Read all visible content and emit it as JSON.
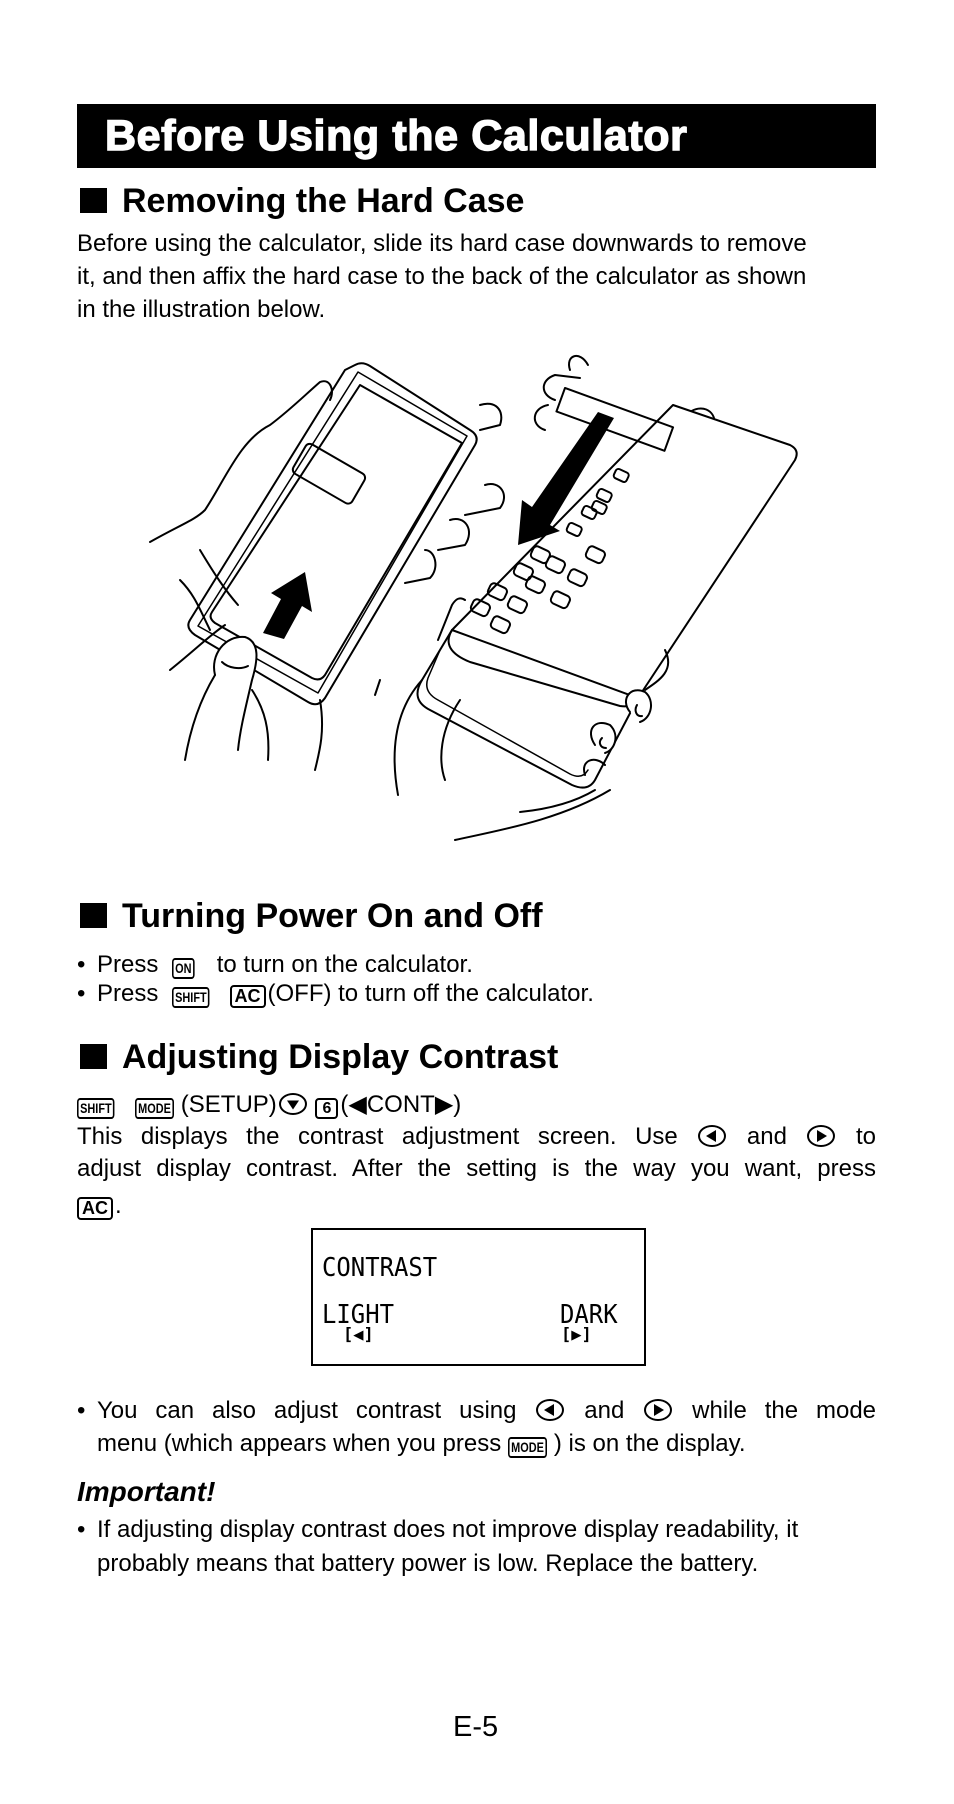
{
  "page": {
    "title": "Before Using the Calculator",
    "page_number": "E-5"
  },
  "sections": {
    "hard_case": {
      "heading": "Removing the Hard Case",
      "paragraph_lines": [
        "Before using the calculator, slide its hard case downwards to remove",
        "it, and then affix the hard case to the back of the calculator as shown",
        "in the illustration below."
      ],
      "illustration": {
        "left_figure": "calculator-back-with-case-slide-up-arrow",
        "right_figure": "calculator-front-case-slide-down-arrow"
      }
    },
    "power": {
      "heading": "Turning Power On and Off",
      "bullets": [
        {
          "prefix": "Press",
          "keys": [
            "ON"
          ],
          "suffix": "to turn on the calculator."
        },
        {
          "prefix": "Press",
          "keys": [
            "SHIFT",
            "AC"
          ],
          "suffix": "(OFF) to turn off the calculator."
        }
      ]
    },
    "contrast": {
      "heading": "Adjusting Display Contrast",
      "sequence": {
        "keys": [
          "SHIFT",
          "MODE"
        ],
        "setup_label": "(SETUP)",
        "down_key": "cursor-down-icon",
        "number_key": "6",
        "cont_label": "(◀CONT▶)"
      },
      "paragraph": {
        "line1_parts": [
          "This displays the contrast adjustment screen. Use",
          "and",
          "to"
        ],
        "line2": "adjust display contrast. After the setting is the way you want, press",
        "line3_key": "AC",
        "line3_suffix": "."
      },
      "lcd_screen": {
        "line1": "CONTRAST",
        "left_label": "LIGHT",
        "left_control": "[◀]",
        "right_label": "DARK",
        "right_control": "[▶]"
      },
      "bullet": {
        "line1_parts": [
          "You can also adjust contrast using",
          "and",
          "while the mode"
        ],
        "line2_prefix": "menu (which appears when you press",
        "line2_key": "MODE",
        "line2_suffix": ") is on the display."
      }
    },
    "important": {
      "heading": "Important!",
      "bullet_lines": [
        "If adjusting display contrast does not improve display readability, it",
        "probably means that battery power is low. Replace the battery."
      ]
    }
  },
  "bullet_char": "•"
}
